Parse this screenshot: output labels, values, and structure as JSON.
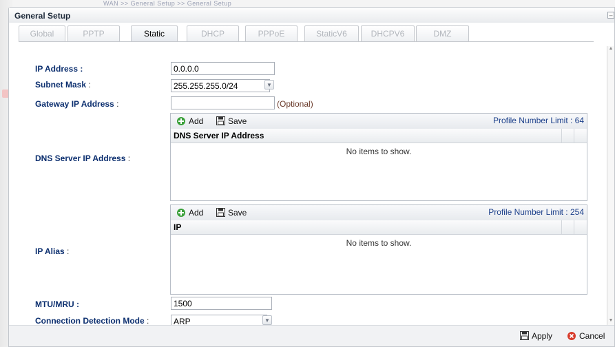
{
  "background": {
    "breadcrumb": "WAN >> General Setup >> General Setup"
  },
  "window": {
    "title": "General Setup"
  },
  "tabs": [
    {
      "label": "Global",
      "state": "normal"
    },
    {
      "label": "PPTP",
      "state": "disabled"
    },
    {
      "label": "Static",
      "state": "active"
    },
    {
      "label": "DHCP",
      "state": "disabled"
    },
    {
      "label": "PPPoE",
      "state": "disabled"
    },
    {
      "label": "StaticV6",
      "state": "disabled"
    },
    {
      "label": "DHCPV6",
      "state": "disabled"
    },
    {
      "label": "DMZ",
      "state": "disabled"
    }
  ],
  "form": {
    "ip_address": {
      "label": "IP Address :",
      "value": "0.0.0.0"
    },
    "subnet_mask": {
      "label": "Subnet Mask",
      "colon": " :",
      "value": "255.255.255.0/24"
    },
    "gateway": {
      "label": "Gateway IP Address",
      "colon": " :",
      "value": "",
      "hint": "(Optional)"
    },
    "dns": {
      "label": "DNS Server IP Address",
      "colon": " :",
      "add_label": "Add",
      "save_label": "Save",
      "limit_text": "Profile Number Limit : 64",
      "column": "DNS Server IP Address",
      "empty": "No items to show."
    },
    "ip_alias": {
      "label": "IP Alias",
      "colon": " :",
      "add_label": "Add",
      "save_label": "Save",
      "limit_text": "Profile Number Limit : 254",
      "column": "IP",
      "empty": "No items to show."
    },
    "mtu": {
      "label": "MTU/MRU :",
      "value": "1500"
    },
    "detection": {
      "label": "Connection Detection Mode",
      "colon": " :",
      "value": "ARP"
    }
  },
  "footer": {
    "apply_label": "Apply",
    "cancel_label": "Cancel"
  },
  "colors": {
    "label": "#0c2f6f",
    "limit": "#1b3f8a",
    "add_icon": "#3aa03a",
    "cancel_icon": "#d83a2a"
  }
}
